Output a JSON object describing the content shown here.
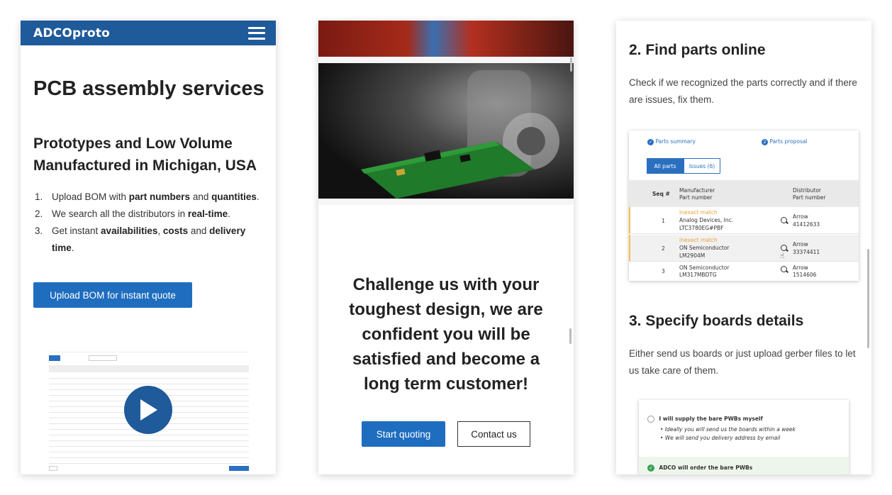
{
  "panel1": {
    "logo": "ADCOproto",
    "title": "PCB assembly services",
    "subtitle": "Prototypes and Low Volume Manufactured in Michigan, USA",
    "steps": [
      {
        "num": "1.",
        "parts": [
          "Upload BOM with ",
          "part numbers",
          " and ",
          "quantities",
          "."
        ]
      },
      {
        "num": "2.",
        "parts": [
          "We search all the distributors in ",
          "real-time",
          "."
        ]
      },
      {
        "num": "3.",
        "parts": [
          "Get instant ",
          "availabilities",
          ", ",
          "costs",
          " and ",
          "delivery time",
          "."
        ]
      }
    ],
    "upload_button": "Upload BOM for instant quote"
  },
  "panel2": {
    "challenge_text": "Challenge us with your toughest design, we are confident you will be satisfied and become a long term customer!",
    "start_button": "Start quoting",
    "contact_button": "Contact us"
  },
  "panel3": {
    "section2_title": "2. Find parts online",
    "section2_text": "Check if we recognized the parts correctly and if there are issues, fix them.",
    "parts_card": {
      "step1": "Parts summary",
      "step2": "Parts proposal",
      "step2_num": "2",
      "tab_all": "All parts",
      "tab_issues": "Issues (6)",
      "col_seq": "Seq #",
      "col_manufacturer": "Manufacturer",
      "col_part_number": "Part number",
      "col_distributor": "Distributor",
      "col_dist_part": "Part number",
      "rows": [
        {
          "seq": "1",
          "status": "Inexact match",
          "manufacturer": "Analog Devices, Inc.",
          "part": "LTC3780EG#PBF",
          "distributor": "Arrow",
          "dist_part": "41412633"
        },
        {
          "seq": "2",
          "status": "Inexact match",
          "manufacturer": "ON Semiconductor",
          "part": "LM2904M",
          "distributor": "Arrow",
          "dist_part": "33374411"
        },
        {
          "seq": "3",
          "status": "",
          "manufacturer": "ON Semiconductor",
          "part": "LM317MBDTG",
          "distributor": "Arrow",
          "dist_part": "1514606"
        }
      ]
    },
    "section3_title": "3. Specify boards details",
    "section3_text": "Either send us boards or just upload gerber files to let us take care of them.",
    "boards_card": {
      "option1": "I will supply the bare PWBs myself",
      "bullet1": "Ideally you will send us the boards within a week",
      "bullet2": "We will send you delivery address by email",
      "option2": "ADCO will order the bare PWBs"
    }
  }
}
